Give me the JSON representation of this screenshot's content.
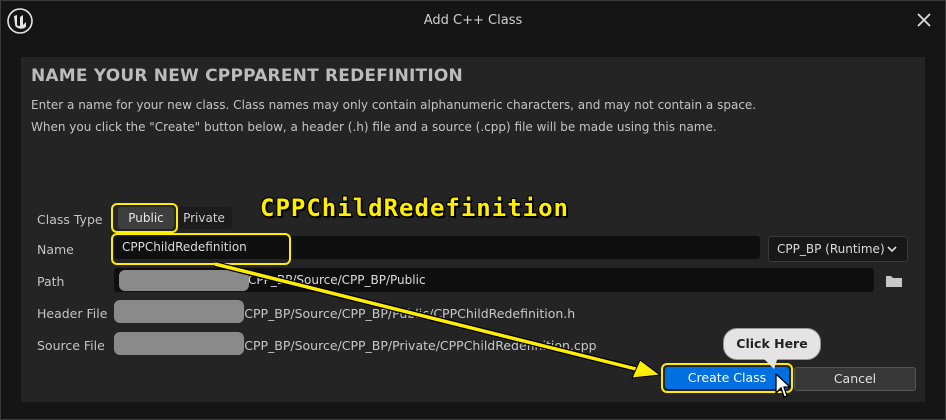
{
  "window": {
    "title": "Add C++ Class"
  },
  "heading": "NAME YOUR NEW CPPPARENT REDEFINITION",
  "description": [
    "Enter a name for your new class. Class names may only contain alphanumeric characters, and may not contain a space.",
    "When you click the \"Create\" button below, a header (.h) file and a source (.cpp) file will be made using this name."
  ],
  "form": {
    "class_type_label": "Class Type",
    "class_type_options": [
      "Public",
      "Private"
    ],
    "class_type_selected": "Public",
    "name_label": "Name",
    "name_value": "CPPChildRedefinition",
    "module": "CPP_BP (Runtime)",
    "path_label": "Path",
    "path_value": "/CPP_BP/Source/CPP_BP/Public",
    "header_label": "Header File",
    "header_value": "/CPP_BP/Source/CPP_BP/Public/CPPChildRedefinition.h",
    "source_label": "Source File",
    "source_value": "/CPP_BP/Source/CPP_BP/Private/CPPChildRedefinition.cpp"
  },
  "buttons": {
    "create": "Create Class",
    "cancel": "Cancel"
  },
  "annotation": {
    "overlay_text": "CPPChildRedefinition",
    "callout": "Click Here"
  },
  "colors": {
    "accent": "#0070e0",
    "highlight": "#ffee00"
  },
  "icons": [
    "unreal-logo-icon",
    "close-icon",
    "chevron-down-icon",
    "folder-icon",
    "mouse-cursor-icon"
  ]
}
